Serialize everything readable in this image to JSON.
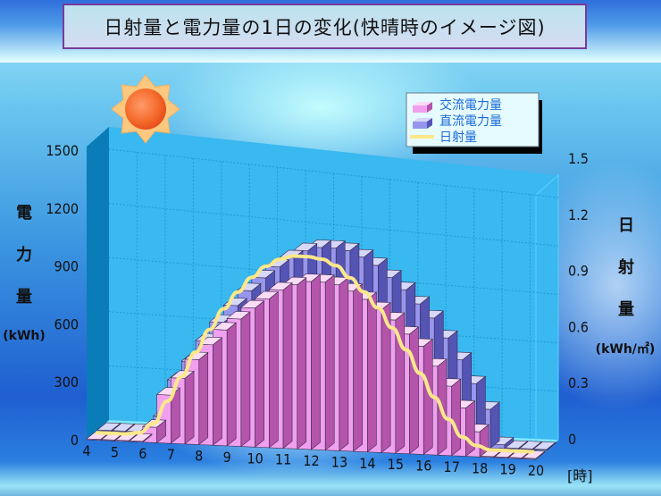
{
  "title": "日射量と電力量の1日の変化(快晴時のイメージ図)",
  "decoration": {
    "sun_icon": "sun-icon"
  },
  "chart_data": {
    "type": "bar",
    "title": "日射量と電力量の1日の変化(快晴時のイメージ図)",
    "xlabel": "[時]",
    "ylabel_left": [
      "電",
      "力",
      "量",
      "(kWh)"
    ],
    "ylabel_right": [
      "日",
      "射",
      "量",
      "(kWh/㎡)"
    ],
    "x_ticks": [
      "4",
      "5",
      "6",
      "7",
      "8",
      "9",
      "10",
      "11",
      "12",
      "13",
      "14",
      "15",
      "16",
      "17",
      "18",
      "19",
      "20"
    ],
    "y_left_ticks": [
      "0",
      "300",
      "600",
      "900",
      "1200",
      "1500"
    ],
    "y_right_ticks": [
      "0",
      "0.3",
      "0.6",
      "0.9",
      "1.2",
      "1.5"
    ],
    "ylim_left": [
      0,
      1500
    ],
    "ylim_right": [
      0,
      1.5
    ],
    "grid": true,
    "legend_position": "top-right",
    "legend": [
      {
        "label": "交流電力量",
        "color": "#f0a0ee"
      },
      {
        "label": "直流電力量",
        "color": "#9a9af0"
      },
      {
        "label": "日射量",
        "color": "#fce88a"
      }
    ],
    "x": [
      4,
      4.5,
      5,
      5.5,
      6,
      6.5,
      7,
      7.5,
      8,
      8.5,
      9,
      9.5,
      10,
      10.5,
      11,
      11.5,
      12,
      12.5,
      13,
      13.5,
      14,
      14.5,
      15,
      15.5,
      16,
      16.5,
      17,
      17.5,
      18,
      18.5,
      19,
      19.5
    ],
    "series": [
      {
        "name": "交流電力量",
        "axis": "left",
        "values": [
          0,
          0,
          0,
          0,
          80,
          250,
          340,
          440,
          520,
          600,
          660,
          720,
          770,
          820,
          850,
          870,
          870,
          860,
          830,
          790,
          740,
          690,
          620,
          560,
          460,
          360,
          250,
          130,
          0,
          0,
          0,
          0
        ]
      },
      {
        "name": "直流電力量",
        "axis": "left",
        "values": [
          0,
          0,
          0,
          0,
          90,
          280,
          380,
          490,
          590,
          680,
          760,
          830,
          890,
          940,
          980,
          1000,
          1000,
          990,
          960,
          920,
          860,
          800,
          730,
          660,
          560,
          450,
          330,
          200,
          20,
          0,
          0,
          0
        ]
      },
      {
        "name": "日射量",
        "axis": "right",
        "type": "line",
        "values": [
          0.02,
          0.02,
          0.02,
          0.03,
          0.08,
          0.2,
          0.33,
          0.46,
          0.58,
          0.69,
          0.78,
          0.86,
          0.92,
          0.96,
          0.98,
          0.98,
          0.97,
          0.94,
          0.88,
          0.81,
          0.73,
          0.63,
          0.52,
          0.4,
          0.28,
          0.17,
          0.08,
          0.04,
          0.02,
          0.02,
          0.02,
          0.02
        ]
      }
    ]
  }
}
